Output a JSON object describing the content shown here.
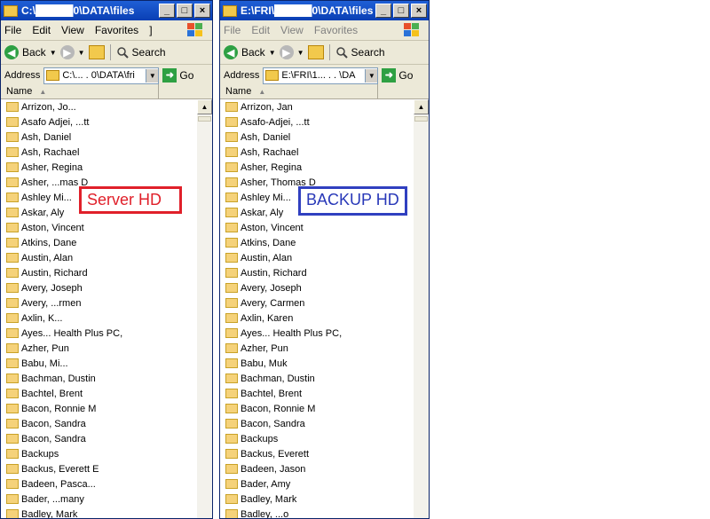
{
  "left_window": {
    "title": "C:\\█████0\\DATA\\files",
    "menu": [
      "File",
      "Edit",
      "View",
      "Favorites",
      "]"
    ],
    "back_label": "Back",
    "search_label": "Search",
    "address_label": "Address",
    "address_value": "C:\\...  . 0\\DATA\\fri",
    "go_label": "Go",
    "column_name": "Name",
    "items": [
      "Arrizon, Jo...",
      "Asafo Adjei, ...tt",
      "Ash, Daniel",
      "Ash, Rachael",
      "Asher, Regina",
      "Asher, ...mas D",
      "Ashley Mi...",
      "Askar, Aly",
      "Aston, Vincent",
      "Atkins, Dane",
      "Austin, Alan",
      "Austin, Richard",
      "Avery, Joseph",
      "Avery, ...rmen",
      "Axlin, K...",
      "Ayes... Health Plus PC,",
      "Azher, Pun",
      "Babu, Mi...",
      "Bachman, Dustin",
      "Bachtel, Brent",
      "Bacon, Ronnie M",
      "Bacon, Sandra",
      "Bacon, Sandra",
      "Backups",
      "Backus, Everett E",
      "Badeen, Pasca...",
      "Bader, ...many",
      "Badley, Mark"
    ],
    "label": "Server HD"
  },
  "right_window": {
    "title": "E:\\FRI\\█████0\\DATA\\files",
    "menu": [
      "File",
      "Edit",
      "View",
      "Favorites"
    ],
    "back_label": "Back",
    "search_label": "Search",
    "address_label": "Address",
    "address_value": "E:\\FRI\\1... . .  \\DA",
    "go_label": "Go",
    "column_name": "Name",
    "items": [
      "Arrizon, Jan",
      "Asafo-Adjei, ...tt",
      "Ash, Daniel",
      "Ash, Rachael",
      "Asher, Regina",
      "Asher, Thomas D",
      "Ashley Mi...",
      "Askar, Aly",
      "Aston, Vincent",
      "Atkins, Dane",
      "Austin, Alan",
      "Austin, Richard",
      "Avery, Joseph",
      "Avery, Carmen",
      "Axlin, Karen",
      "Ayes... Health Plus PC,",
      "Azher, Pun",
      "Babu, Muk",
      "Bachman, Dustin",
      "Bachtel, Brent",
      "Bacon, Ronnie M",
      "Bacon, Sandra",
      "Backups",
      "Backus, Everett",
      "Badeen, Jason",
      "Bader, Amy",
      "Badley, Mark",
      "Badley, ...o"
    ],
    "label": "BACKUP HD"
  },
  "colors": {
    "server_label": "#e0202a",
    "backup_label": "#3040c0",
    "titlebar": "#0a3fb4"
  }
}
